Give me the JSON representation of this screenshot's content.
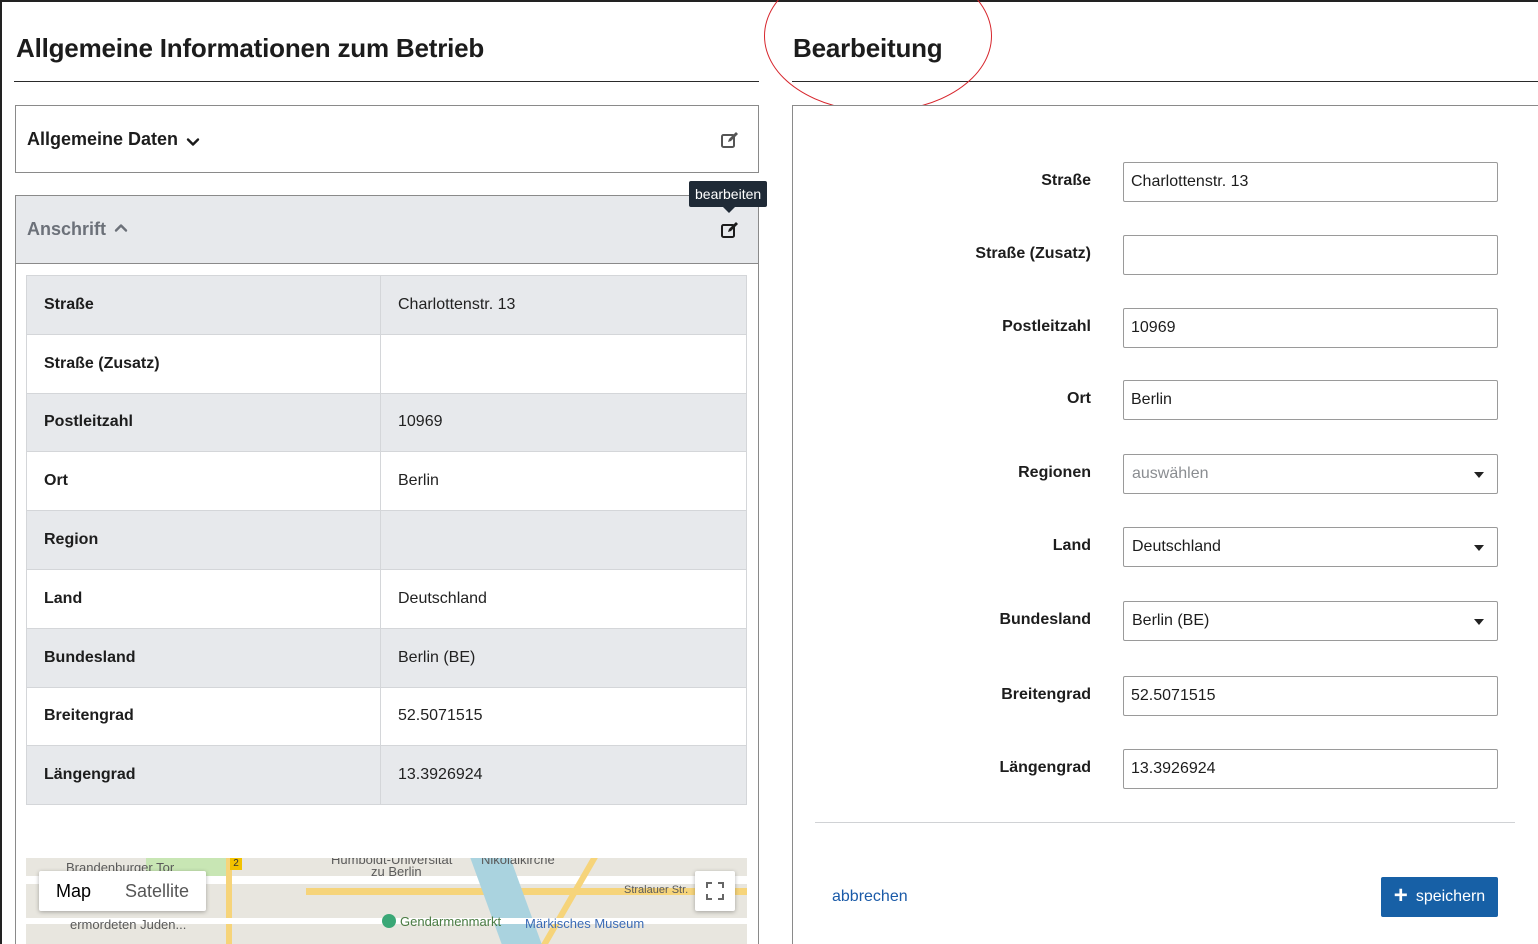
{
  "left": {
    "heading": "Allgemeine Informationen zum Betrieb",
    "general_panel": {
      "title": "Allgemeine Daten"
    },
    "address_panel": {
      "title": "Anschrift",
      "tooltip": "bearbeiten",
      "rows": [
        {
          "label": "Straße",
          "value": "Charlottenstr. 13"
        },
        {
          "label": "Straße (Zusatz)",
          "value": ""
        },
        {
          "label": "Postleitzahl",
          "value": "10969"
        },
        {
          "label": "Ort",
          "value": "Berlin"
        },
        {
          "label": "Region",
          "value": ""
        },
        {
          "label": "Land",
          "value": "Deutschland"
        },
        {
          "label": "Bundesland",
          "value": "Berlin (BE)"
        },
        {
          "label": "Breitengrad",
          "value": "52.5071515"
        },
        {
          "label": "Längengrad",
          "value": "13.3926924"
        }
      ]
    },
    "map": {
      "type_map": "Map",
      "type_satellite": "Satellite",
      "labels": {
        "brandenburger_tor": "Brandenburger Tor",
        "humboldt": "Humboldt-Universität",
        "zu_berlin": "zu Berlin",
        "nikolaikirche": "Nikolaikirche",
        "stralauer": "Stralauer Str.",
        "ermordeten": "ermordeten Juden...",
        "gendarmenmarkt": "Gendarmenmarkt",
        "maerkisches": "Märkisches Museum",
        "line_2": "2"
      }
    }
  },
  "right": {
    "heading": "Bearbeitung",
    "fields": [
      {
        "label": "Straße",
        "value": "Charlottenstr. 13",
        "kind": "input"
      },
      {
        "label": "Straße (Zusatz)",
        "value": "",
        "kind": "input"
      },
      {
        "label": "Postleitzahl",
        "value": "10969",
        "kind": "input"
      },
      {
        "label": "Ort",
        "value": "Berlin",
        "kind": "input"
      },
      {
        "label": "Regionen",
        "placeholder": "auswählen",
        "kind": "select"
      },
      {
        "label": "Land",
        "value": "Deutschland",
        "kind": "select"
      },
      {
        "label": "Bundesland",
        "value": "Berlin (BE)",
        "kind": "select"
      },
      {
        "label": "Breitengrad",
        "value": "52.5071515",
        "kind": "input"
      },
      {
        "label": "Längengrad",
        "value": "13.3926924",
        "kind": "input"
      }
    ],
    "cancel_label": "abbrechen",
    "save_label": "speichern"
  },
  "colors": {
    "accent": "#1760a6",
    "link": "#1a5aa8",
    "highlight_circle": "#d7262d",
    "tooltip_bg": "#1f2a36"
  }
}
